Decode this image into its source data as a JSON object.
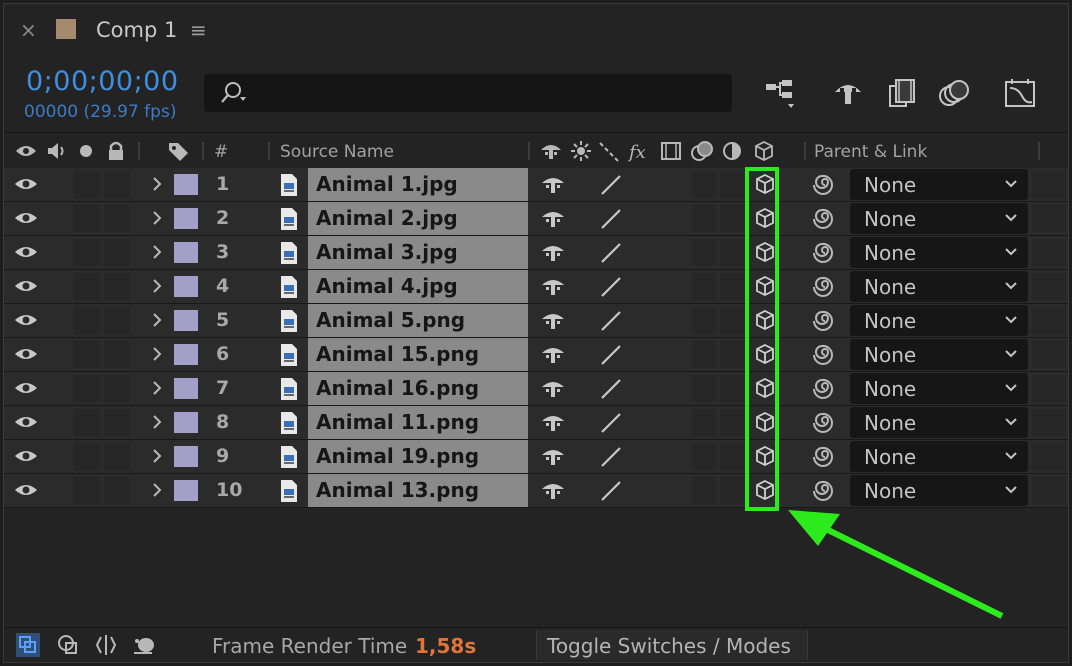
{
  "tab": {
    "close": "×",
    "title": "Comp 1",
    "menu": "≡",
    "swatch_color": "#a58a6d"
  },
  "time": {
    "timecode": "0;00;00;00",
    "frames_fps": "00000 (29.97 fps)"
  },
  "search": {
    "placeholder": ""
  },
  "toolbar": {
    "icons": [
      "composition-flowchart-icon",
      "shy-layers-icon",
      "frame-blending-icon",
      "motion-blur-icon",
      "graph-editor-icon"
    ]
  },
  "header": {
    "number": "#",
    "source_name": "Source Name",
    "parent_link": "Parent & Link",
    "icons": [
      "eye-icon",
      "audio-icon",
      "solo-icon",
      "lock-icon",
      "label-icon",
      "shy-icon",
      "collapse-icon",
      "quality-icon",
      "effects-icon",
      "frame-blend-icon",
      "motion-blur-icon",
      "adjustment-icon",
      "3d-layer-icon"
    ]
  },
  "layers": [
    {
      "num": "1",
      "name": "Animal 1.jpg",
      "parent": "None"
    },
    {
      "num": "2",
      "name": "Animal 2.jpg",
      "parent": "None"
    },
    {
      "num": "3",
      "name": "Animal 3.jpg",
      "parent": "None"
    },
    {
      "num": "4",
      "name": "Animal 4.jpg",
      "parent": "None"
    },
    {
      "num": "5",
      "name": "Animal 5.png",
      "parent": "None"
    },
    {
      "num": "6",
      "name": "Animal 15.png",
      "parent": "None"
    },
    {
      "num": "7",
      "name": "Animal 16.png",
      "parent": "None"
    },
    {
      "num": "8",
      "name": "Animal 11.png",
      "parent": "None"
    },
    {
      "num": "9",
      "name": "Animal 19.png",
      "parent": "None"
    },
    {
      "num": "10",
      "name": "Animal 13.png",
      "parent": "None"
    }
  ],
  "colors": {
    "label": "#a29fc8",
    "highlight": "#2dea1c",
    "timecode": "#3d8fe0",
    "render_time": "#e0743a"
  },
  "footer": {
    "render_label": "Frame Render Time",
    "render_value": "1,58s",
    "toggle_label": "Toggle Switches / Modes"
  }
}
